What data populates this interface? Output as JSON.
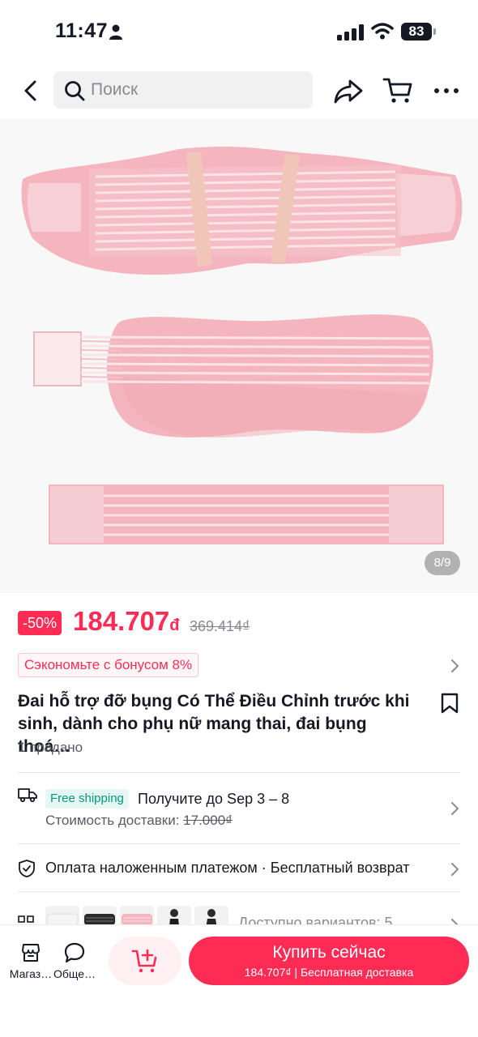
{
  "status_bar": {
    "time": "11:47",
    "battery": "83"
  },
  "header": {
    "search_placeholder": "Поиск"
  },
  "gallery": {
    "counter": "8/9"
  },
  "price": {
    "discount": "-50%",
    "current": "184.707",
    "currency": "đ",
    "original": "369.414₫"
  },
  "bonus": {
    "label": "Сэкономьте с бонусом 8%"
  },
  "product": {
    "title": "Đai hỗ trợ đỡ bụng Có Thể Điều Chỉnh trước khi sinh, dành cho phụ nữ mang thai, đai bụng thoá…",
    "sold": "1 продано"
  },
  "shipping": {
    "tag": "Free shipping",
    "eta": "Получите до Sep 3 – 8",
    "cost_label": "Стоимость доставки: ",
    "cost_old": "17.000₫"
  },
  "payment": {
    "text": "Оплата наложенным платежом · Бесплатный возврат"
  },
  "variants": {
    "text": "Доступно вариантов: 5"
  },
  "bottom_bar": {
    "shop_label": "Магаз…",
    "chat_label": "Обще…",
    "buy_label": "Купить сейчас",
    "buy_sub": "184.707₫ | Бесплатная доставка"
  },
  "colors": {
    "accent": "#fe2c55",
    "product_pink": "#f5b8c0",
    "free_shipping": "#00997a"
  }
}
